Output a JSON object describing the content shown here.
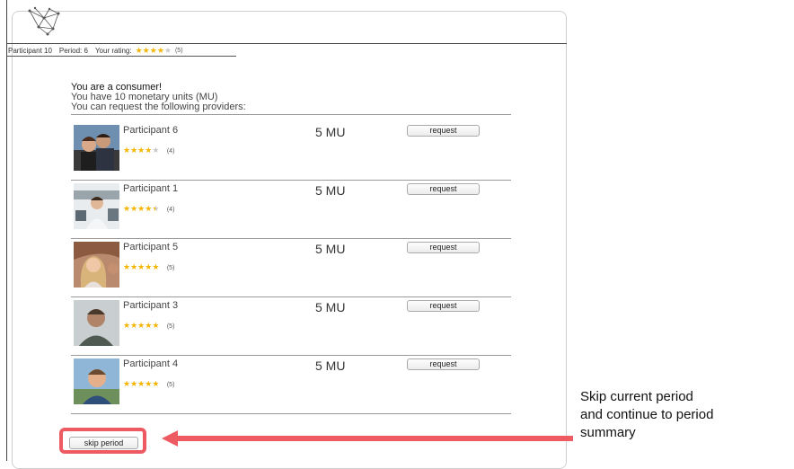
{
  "status": {
    "participant": "Participant 10",
    "period": "Period: 6",
    "rating_label": "Your rating:",
    "rating_value": 4,
    "rating_count": "(5)"
  },
  "intro": {
    "line1": "You are a consumer!",
    "line2": "You have 10 monetary units (MU)",
    "line3": "You can request the following providers:"
  },
  "providers": [
    {
      "name": "Participant 6",
      "price": "5 MU",
      "rating": 4,
      "count": "(4)",
      "button": "request"
    },
    {
      "name": "Participant 1",
      "price": "5 MU",
      "rating": 4.5,
      "count": "(4)",
      "button": "request"
    },
    {
      "name": "Participant 5",
      "price": "5 MU",
      "rating": 5,
      "count": "(5)",
      "button": "request"
    },
    {
      "name": "Participant 3",
      "price": "5 MU",
      "rating": 5,
      "count": "(5)",
      "button": "request"
    },
    {
      "name": "Participant 4",
      "price": "5 MU",
      "rating": 5,
      "count": "(5)",
      "button": "request"
    }
  ],
  "skip_button": "skip period",
  "annotation": {
    "line1": "Skip current period",
    "line2": "and continue to period",
    "line3": "summary"
  },
  "colors": {
    "star": "#f4b400",
    "highlight": "#ee5a62"
  }
}
